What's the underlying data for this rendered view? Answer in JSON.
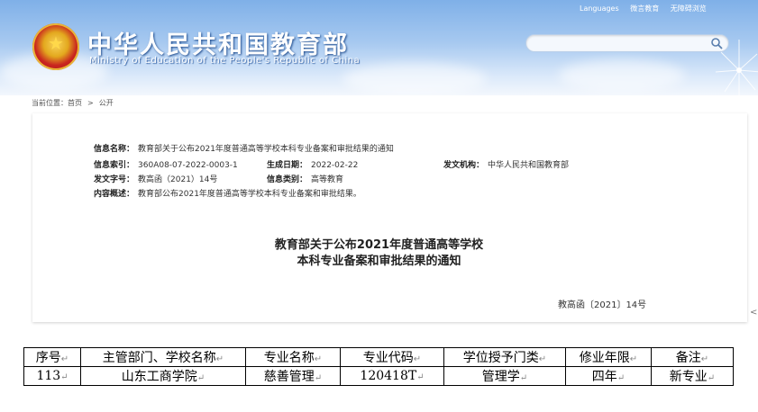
{
  "header": {
    "site_title": "中华人民共和国教育部",
    "site_subtitle": "Ministry of Education of the People's Republic of China",
    "top_links": [
      "Languages",
      "微言教育",
      "无障碍浏览"
    ]
  },
  "breadcrumb": {
    "prefix": "当前位置：",
    "items": [
      "首页",
      "公开"
    ]
  },
  "meta": {
    "title_label": "信息名称：",
    "title_value": "教育部关于公布2021年度普通高等学校本科专业备案和审批结果的通知",
    "index_label": "信息索引：",
    "index_value": "360A08-07-2022-0003-1",
    "date_label": "生成日期：",
    "date_value": "2022-02-22",
    "org_label": "发文机构：",
    "org_value": "中华人民共和国教育部",
    "docno_label": "发文字号：",
    "docno_value": "教高函（2021）14号",
    "category_label": "信息类别：",
    "category_value": "高等教育",
    "summary_label": "内容概述：",
    "summary_value": "教育部公布2021年度普通高等学校本科专业备案和审批结果。"
  },
  "document": {
    "title_line1": "教育部关于公布2021年度普通高等学校",
    "title_line2": "本科专业备案和审批结果的通知",
    "doc_number": "教高函〔2021〕14号"
  },
  "table": {
    "headers": [
      "序号",
      "主管部门、学校名称",
      "专业名称",
      "专业代码",
      "学位授予门类",
      "修业年限",
      "备注"
    ],
    "row": [
      "113",
      "山东工商学院",
      "慈善管理",
      "120418T",
      "管理学",
      "四年",
      "新专业"
    ],
    "mark": "↵"
  },
  "colors": {
    "header_sky": "#7fb0e8",
    "emblem_red": "#c9251f",
    "emblem_gold": "#f8d35a"
  }
}
